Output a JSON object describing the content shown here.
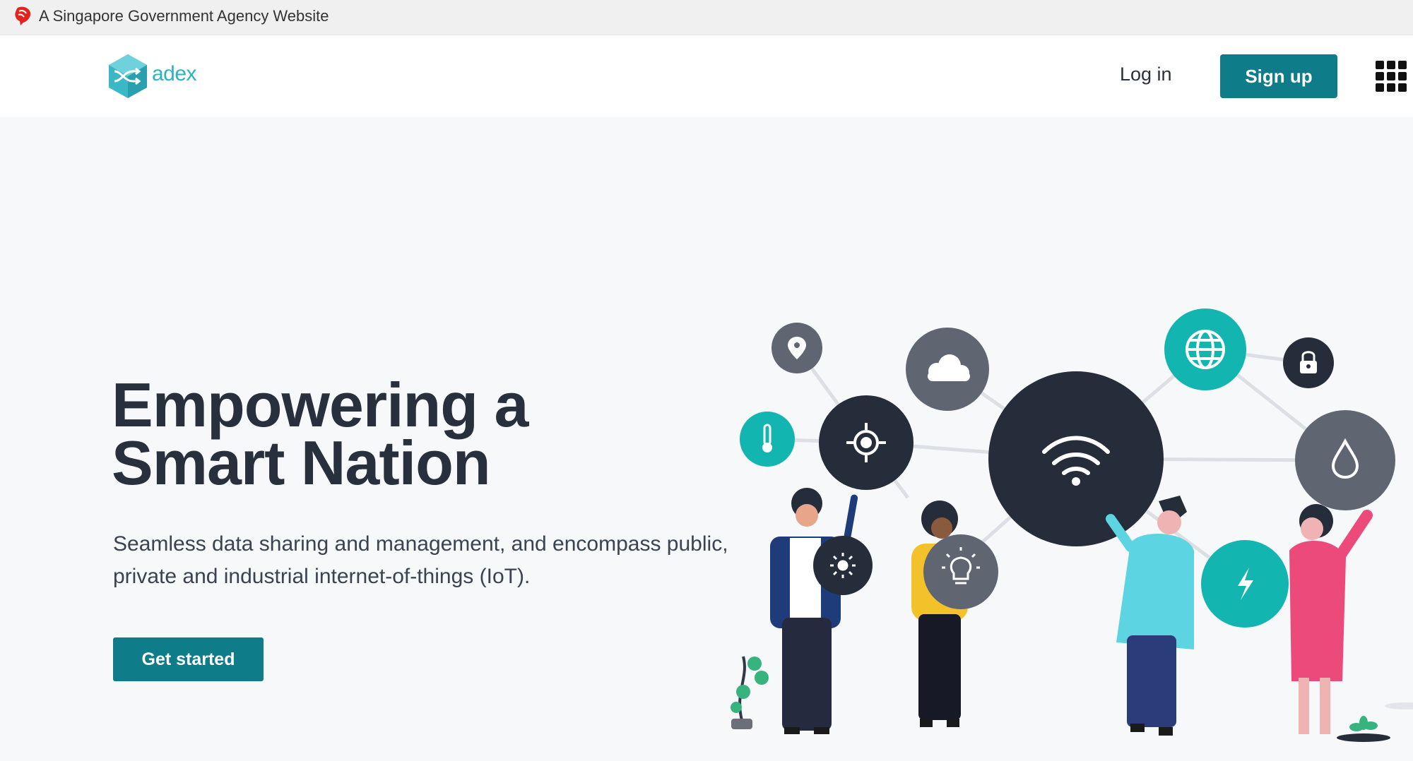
{
  "gov_banner": {
    "text": "A Singapore Government Agency Website",
    "icon": "lion-head-icon"
  },
  "header": {
    "logo_text": "adex",
    "login_label": "Log in",
    "signup_label": "Sign up",
    "apps_icon": "grid-menu-icon"
  },
  "hero": {
    "title_line1": "Empowering a",
    "title_line2": "Smart Nation",
    "subtitle": "Seamless data sharing and management, and encompass public, private and industrial internet-of-things (IoT).",
    "cta_label": "Get started"
  },
  "illustration": {
    "icons": [
      "location-pin-icon",
      "cloud-icon",
      "globe-icon",
      "lock-icon",
      "thermometer-icon",
      "crosshair-icon",
      "wifi-icon",
      "water-drop-icon",
      "sun-icon",
      "lightbulb-icon",
      "lightning-icon"
    ]
  },
  "colors": {
    "primary": "#0f7c8a",
    "logo": "#2bb3c0",
    "teal_circle": "#12b5b0",
    "dark_circle": "#262d3a",
    "grey_circle": "#5f6672",
    "background": "#f7f8f9"
  }
}
